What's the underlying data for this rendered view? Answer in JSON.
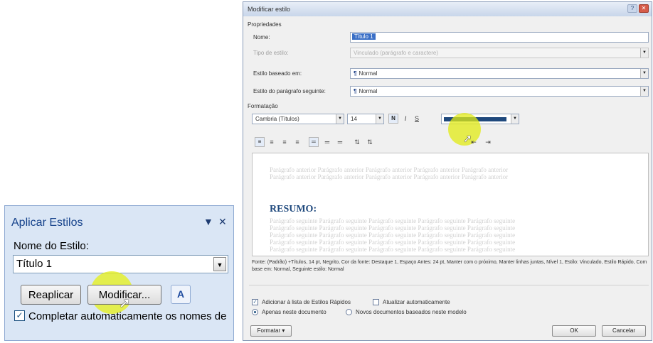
{
  "apply_styles": {
    "title": "Aplicar Estilos",
    "dropdown_glyph": "▼",
    "close_glyph": "✕",
    "style_name_label": "Nome do Estilo:",
    "style_name_value": "Título 1",
    "reapply_label": "Reaplicar",
    "modify_label": "Modificar...",
    "styles_icon_glyph": "A",
    "autocomplete_label": "Completar automaticamente os nomes de",
    "autocomplete_checked": true
  },
  "dialog": {
    "title": "Modificar estilo",
    "properties_section": "Propriedades",
    "name_label": "Nome:",
    "name_value": "Título 1",
    "style_type_label": "Tipo de estilo:",
    "style_type_value": "Vinculado (parágrafo e caractere)",
    "based_on_label": "Estilo baseado em:",
    "based_on_value": "Normal",
    "following_label": "Estilo do parágrafo seguinte:",
    "following_value": "Normal",
    "paragraph_mark": "¶",
    "formatting_section": "Formatação",
    "font_value": "Cambria (Títulos)",
    "size_value": "14",
    "bold_glyph": "N",
    "italic_glyph": "I",
    "underline_glyph": "S",
    "font_color": "#1f497d",
    "preview_previous_line1": "Parágrafo anterior Parágrafo anterior Parágrafo anterior Parágrafo anterior Parágrafo anterior",
    "preview_previous_line2": "Parágrafo anterior Parágrafo anterior Parágrafo anterior Parágrafo anterior Parágrafo anterior",
    "preview_heading": "RESUMO:",
    "preview_next_line": "Parágrafo seguinte Parágrafo seguinte Parágrafo seguinte Parágrafo seguinte Parágrafo seguinte",
    "description": "Fonte: (Padrão) +Títulos, 14 pt, Negrito, Cor da fonte: Destaque 1, Espaço Antes: 24 pt, Manter com o próximo, Manter linhas juntas, Nível 1, Estilo: Vinculado, Estilo Rápido, Com base em: Normal, Seguinte estilo: Normal",
    "add_quick_styles_label": "Adicionar à lista de Estilos Rápidos",
    "add_quick_styles_checked": true,
    "auto_update_label": "Atualizar automaticamente",
    "auto_update_checked": false,
    "only_doc_label": "Apenas neste documento",
    "new_docs_label": "Novos documentos baseados neste modelo",
    "format_button": "Formatar ▾",
    "ok_button": "OK",
    "cancel_button": "Cancelar"
  }
}
